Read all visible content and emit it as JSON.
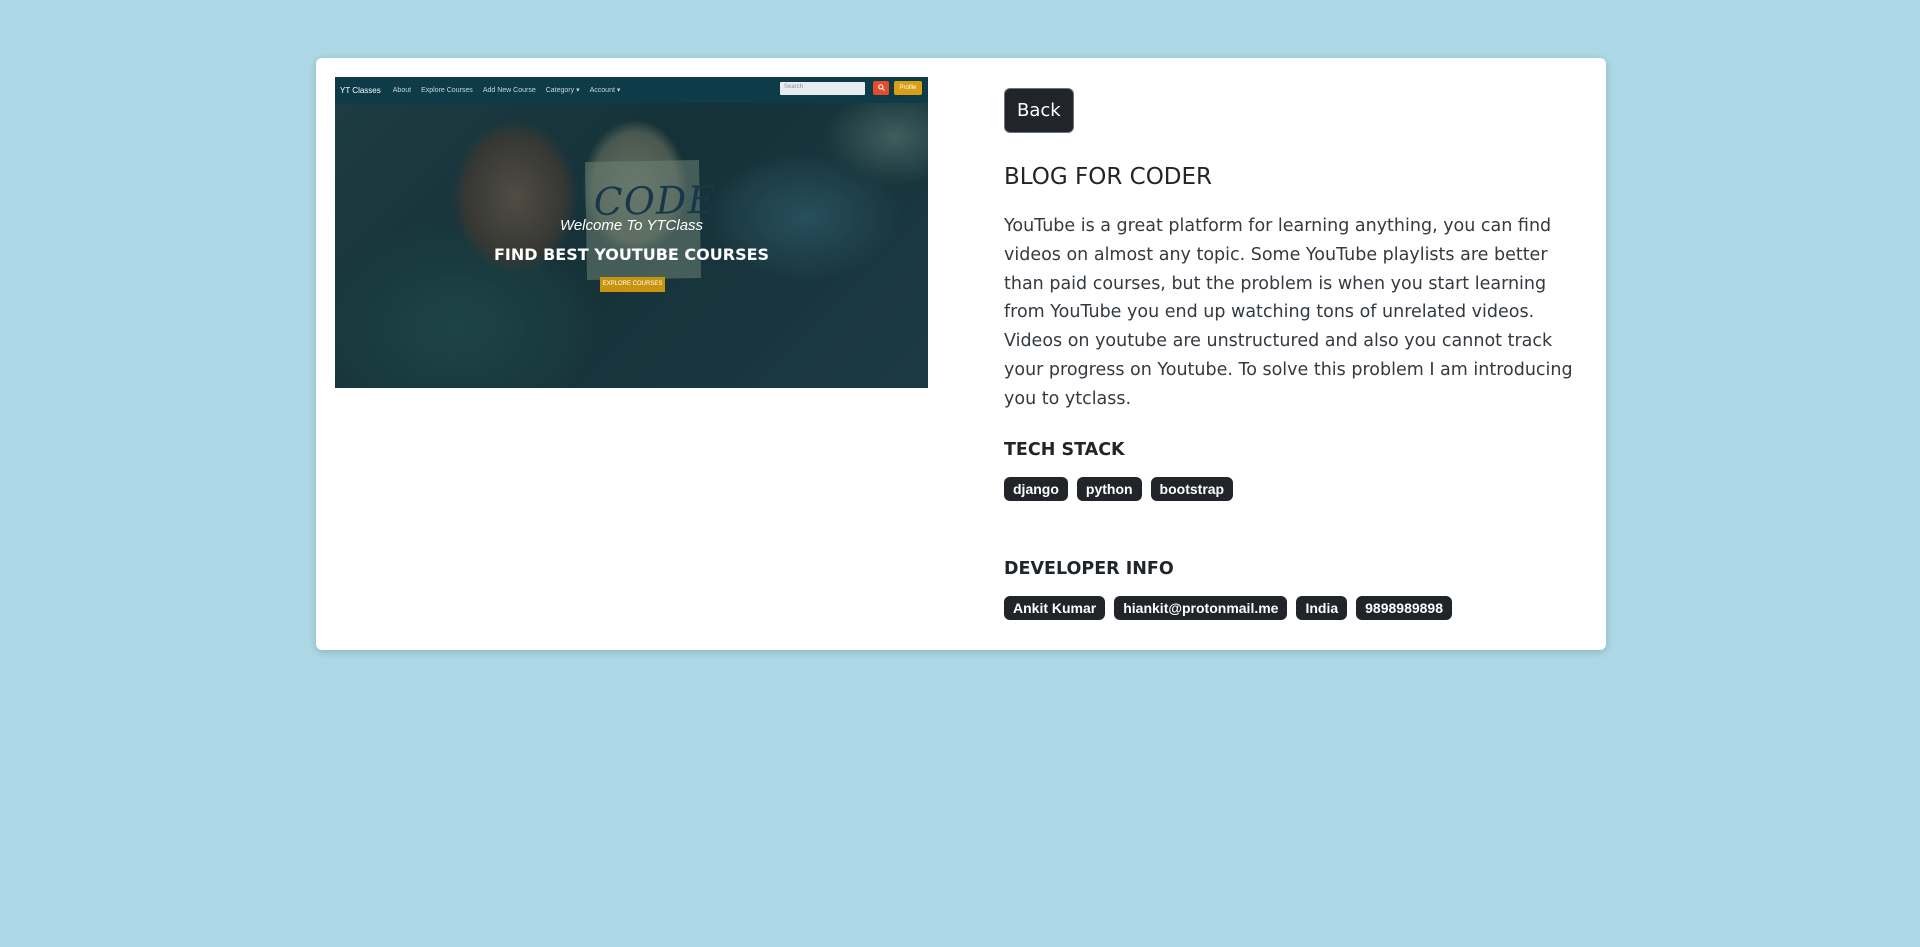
{
  "preview": {
    "nav": {
      "brand": "YT Classes",
      "links": [
        "About",
        "Explore Courses",
        "Add New Course",
        "Category ▾",
        "Account ▾"
      ],
      "search_placeholder": "Search",
      "search_icon": "search-icon",
      "profile_label": "Profile"
    },
    "note_text": "CODE",
    "welcome": "Welcome To YTClass",
    "heading": "FIND BEST YOUTUBE COURSES",
    "cta_label": "EXPLORE COURSES"
  },
  "back_label": "Back",
  "project": {
    "title": "BLOG FOR CODER",
    "description": "YouTube is a great platform for learning anything, you can find videos on almost any topic. Some YouTube playlists are better than paid courses, but the problem is when you start learning from YouTube you end up watching tons of unrelated videos. Videos on youtube are unstructured and also you cannot track your progress on Youtube. To solve this problem I am introducing you to ytclass."
  },
  "tech_stack": {
    "heading": "TECH STACK",
    "items": [
      "django",
      "python",
      "bootstrap"
    ]
  },
  "developer": {
    "heading": "DEVELOPER INFO",
    "name": "Ankit Kumar",
    "email": "hiankit@protonmail.me",
    "country": "India",
    "phone": "9898989898"
  },
  "colors": {
    "page_background": "#add8e6",
    "card_background": "#ffffff",
    "badge_background": "#212529",
    "preview_search_button": "#e24d2b",
    "preview_profile_button": "#d8a012"
  }
}
